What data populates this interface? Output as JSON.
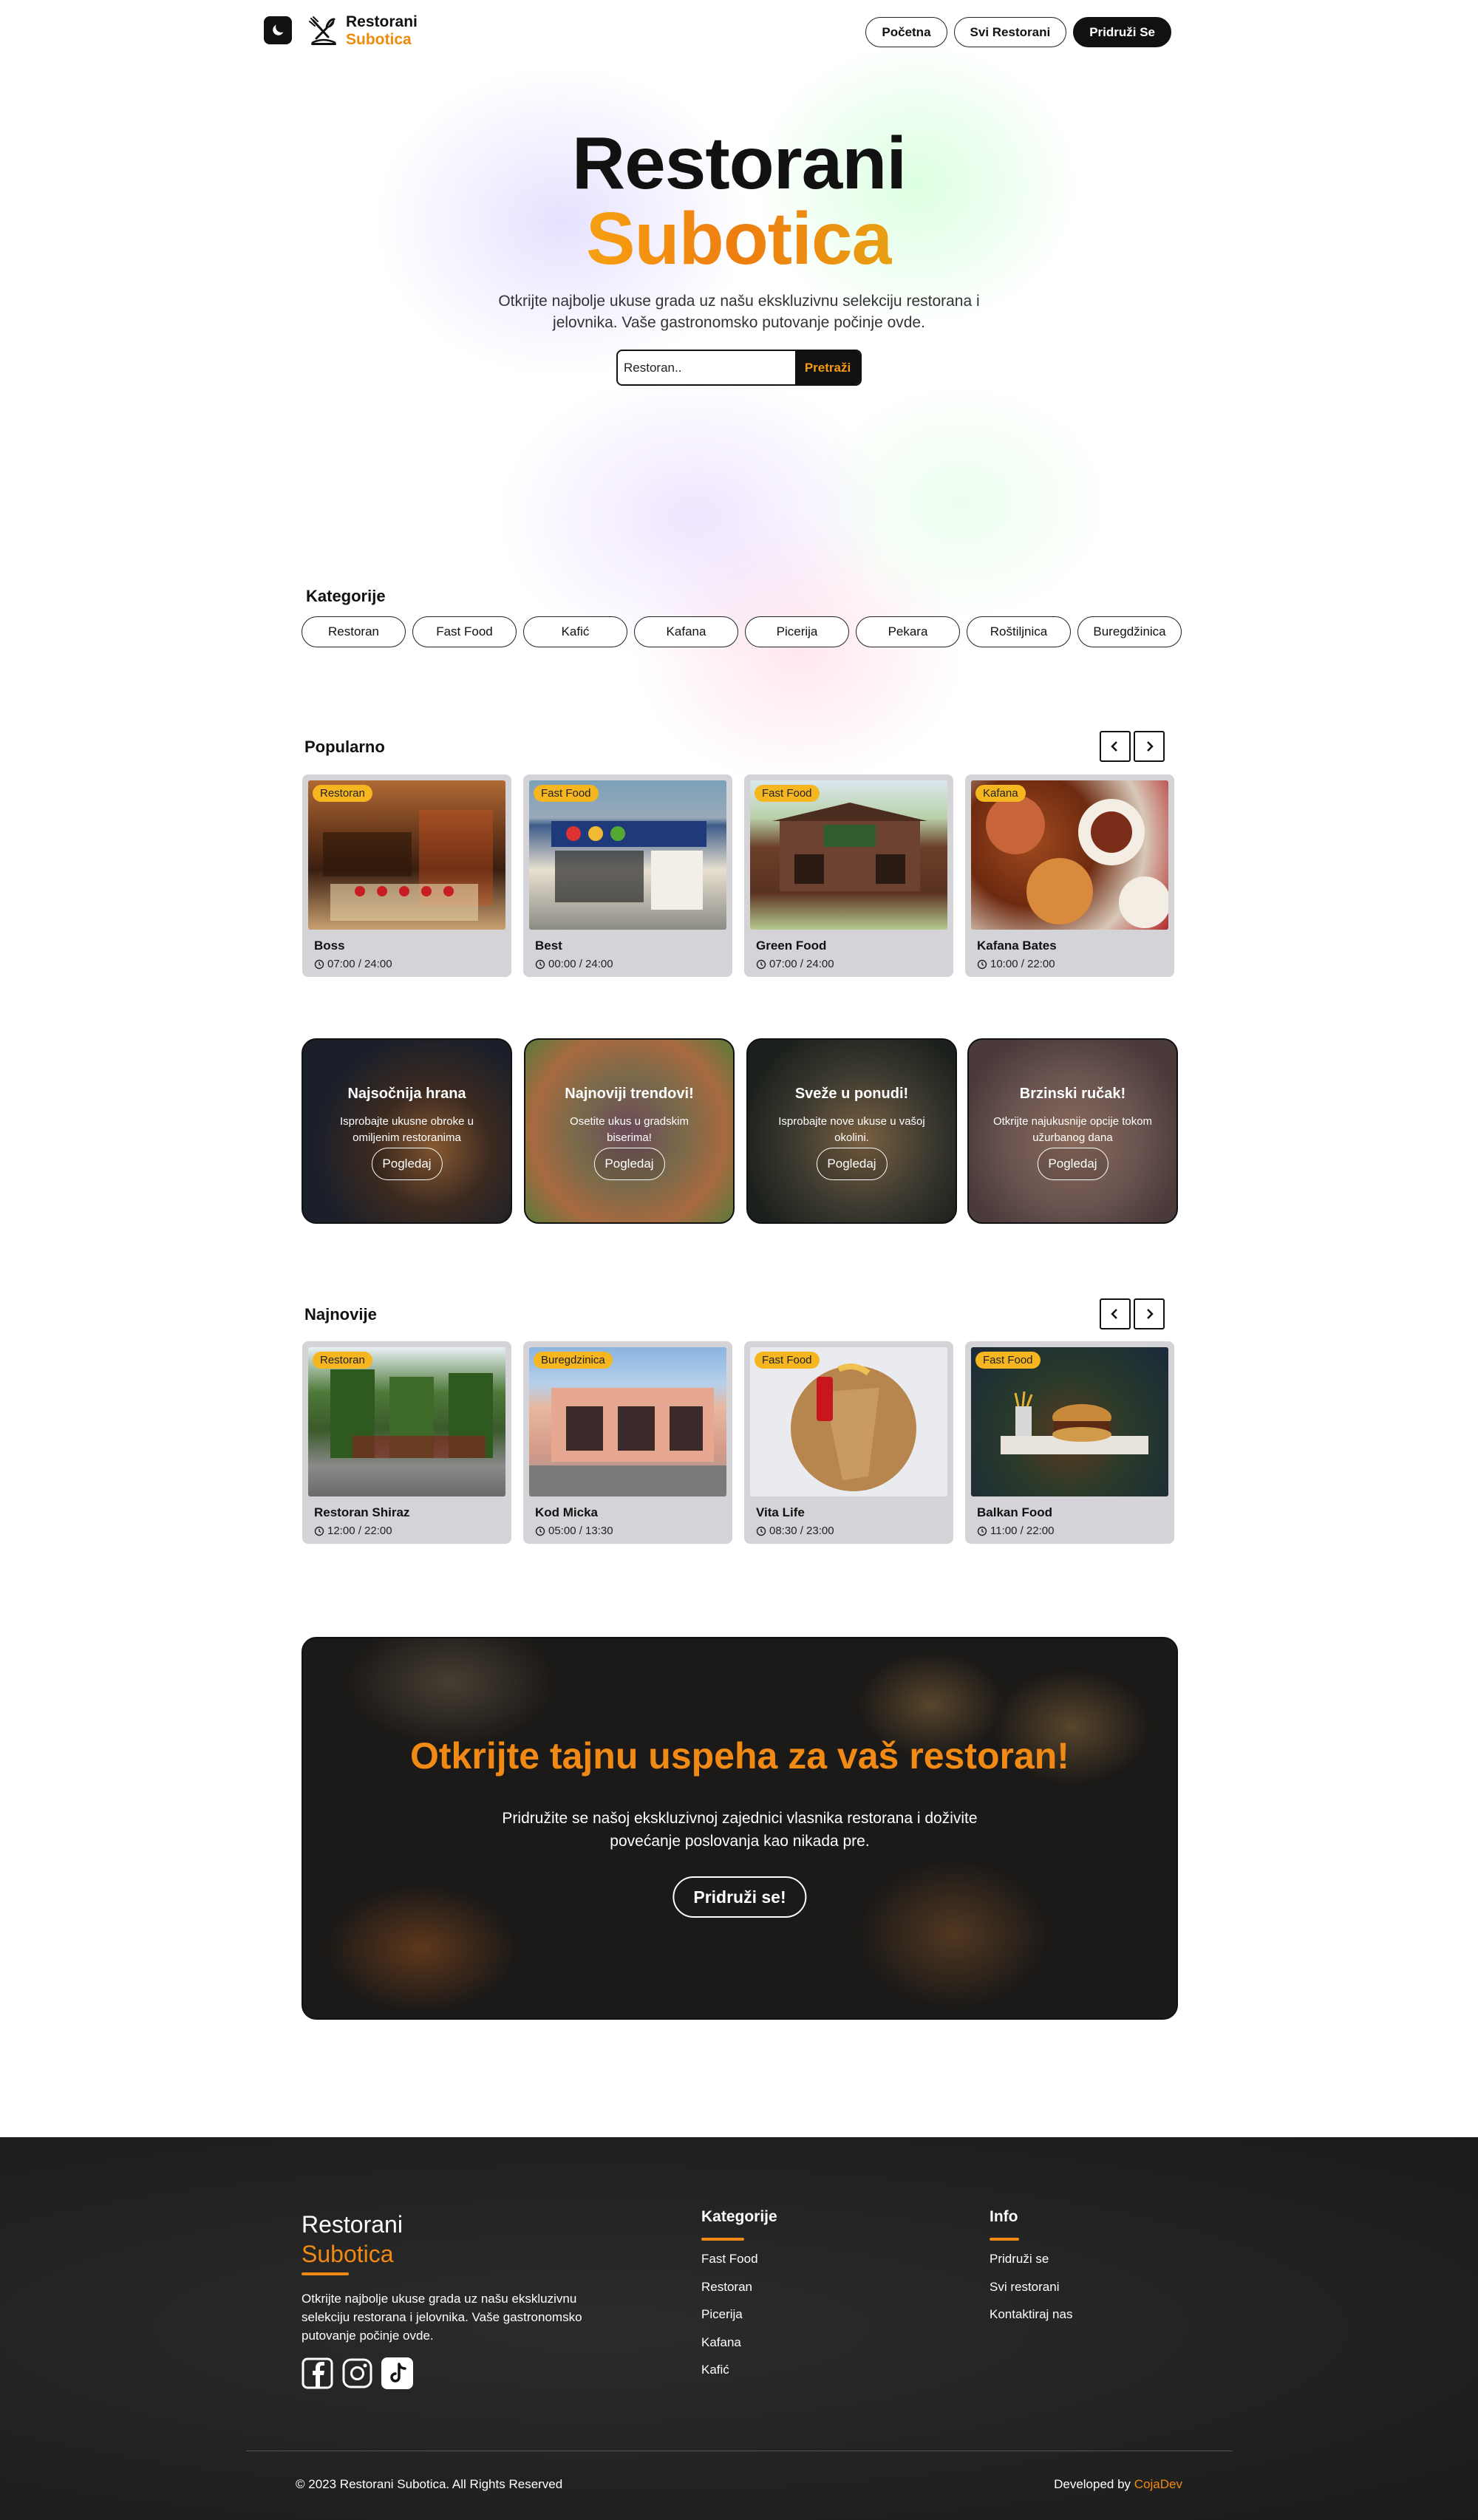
{
  "brand": {
    "line1": "Restorani",
    "line2": "Subotica"
  },
  "nav": {
    "home": "Početna",
    "all": "Svi Restorani",
    "join": "Pridruži Se"
  },
  "hero": {
    "title1": "Restorani",
    "title2": "Subotica",
    "subtitle": "Otkrijte najbolje ukuse grada uz našu ekskluzivnu selekciju restorana i jelovnika. Vaše gastronomsko putovanje počinje ovde.",
    "search_placeholder": "Restoran..",
    "search_button": "Pretraži"
  },
  "categories": {
    "title": "Kategorije",
    "items": [
      "Restoran",
      "Fast Food",
      "Kafić",
      "Kafana",
      "Picerija",
      "Pekara",
      "Roštiljnica",
      "Buregdžinica"
    ]
  },
  "popular": {
    "title": "Popularno",
    "cards": [
      {
        "tag": "Restoran",
        "name": "Boss",
        "hours": "07:00 / 24:00"
      },
      {
        "tag": "Fast Food",
        "name": "Best",
        "hours": "00:00 / 24:00"
      },
      {
        "tag": "Fast Food",
        "name": "Green Food",
        "hours": "07:00 / 24:00"
      },
      {
        "tag": "Kafana",
        "name": "Kafana Bates",
        "hours": "10:00 / 22:00"
      }
    ]
  },
  "promos": [
    {
      "title": "Najsočnija hrana",
      "desc": "Isprobajte ukusne obroke u omiljenim restoranima",
      "button": "Pogledaj"
    },
    {
      "title": "Najnoviji trendovi!",
      "desc": "Osetite ukus u gradskim biserima!",
      "button": "Pogledaj"
    },
    {
      "title": "Sveže u ponudi!",
      "desc": "Isprobajte nove ukuse u vašoj okolini.",
      "button": "Pogledaj"
    },
    {
      "title": "Brzinski ručak!",
      "desc": "Otkrijte najukusnije opcije tokom užurbanog dana",
      "button": "Pogledaj"
    }
  ],
  "latest": {
    "title": "Najnovije",
    "cards": [
      {
        "tag": "Restoran",
        "name": "Restoran Shiraz",
        "hours": "12:00 / 22:00"
      },
      {
        "tag": "Buregdzinica",
        "name": "Kod Micka",
        "hours": "05:00 / 13:30"
      },
      {
        "tag": "Fast Food",
        "name": "Vita Life",
        "hours": "08:30 / 23:00"
      },
      {
        "tag": "Fast Food",
        "name": "Balkan Food",
        "hours": "11:00 / 22:00"
      }
    ]
  },
  "cta": {
    "title": "Otkrijte tajnu uspeha za vaš restoran!",
    "desc": "Pridružite se našoj ekskluzivnoj zajednici vlasnika restorana i doživite povećanje poslovanja kao nikada pre.",
    "button": "Pridruži se!"
  },
  "footer": {
    "brand1": "Restorani",
    "brand2": "Subotica",
    "desc": "Otkrijte najbolje ukuse grada uz našu ekskluzivnu selekciju restorana i jelovnika. Vaše gastronomsko putovanje počinje ovde.",
    "cat_title": "Kategorije",
    "cat_links": [
      "Fast Food",
      "Restoran",
      "Picerija",
      "Kafana",
      "Kafić"
    ],
    "info_title": "Info",
    "info_links": [
      "Pridruži se",
      "Svi restorani",
      "Kontaktiraj nas"
    ],
    "copyright": "© 2023 Restorani Subotica. All Rights Reserved",
    "dev_prefix": "Developed by",
    "dev_name": "CojaDev"
  },
  "colors": {
    "accent": "#f08a14",
    "tag": "#f5b620",
    "dark": "#111111",
    "card_bg": "#d4d4d8"
  }
}
